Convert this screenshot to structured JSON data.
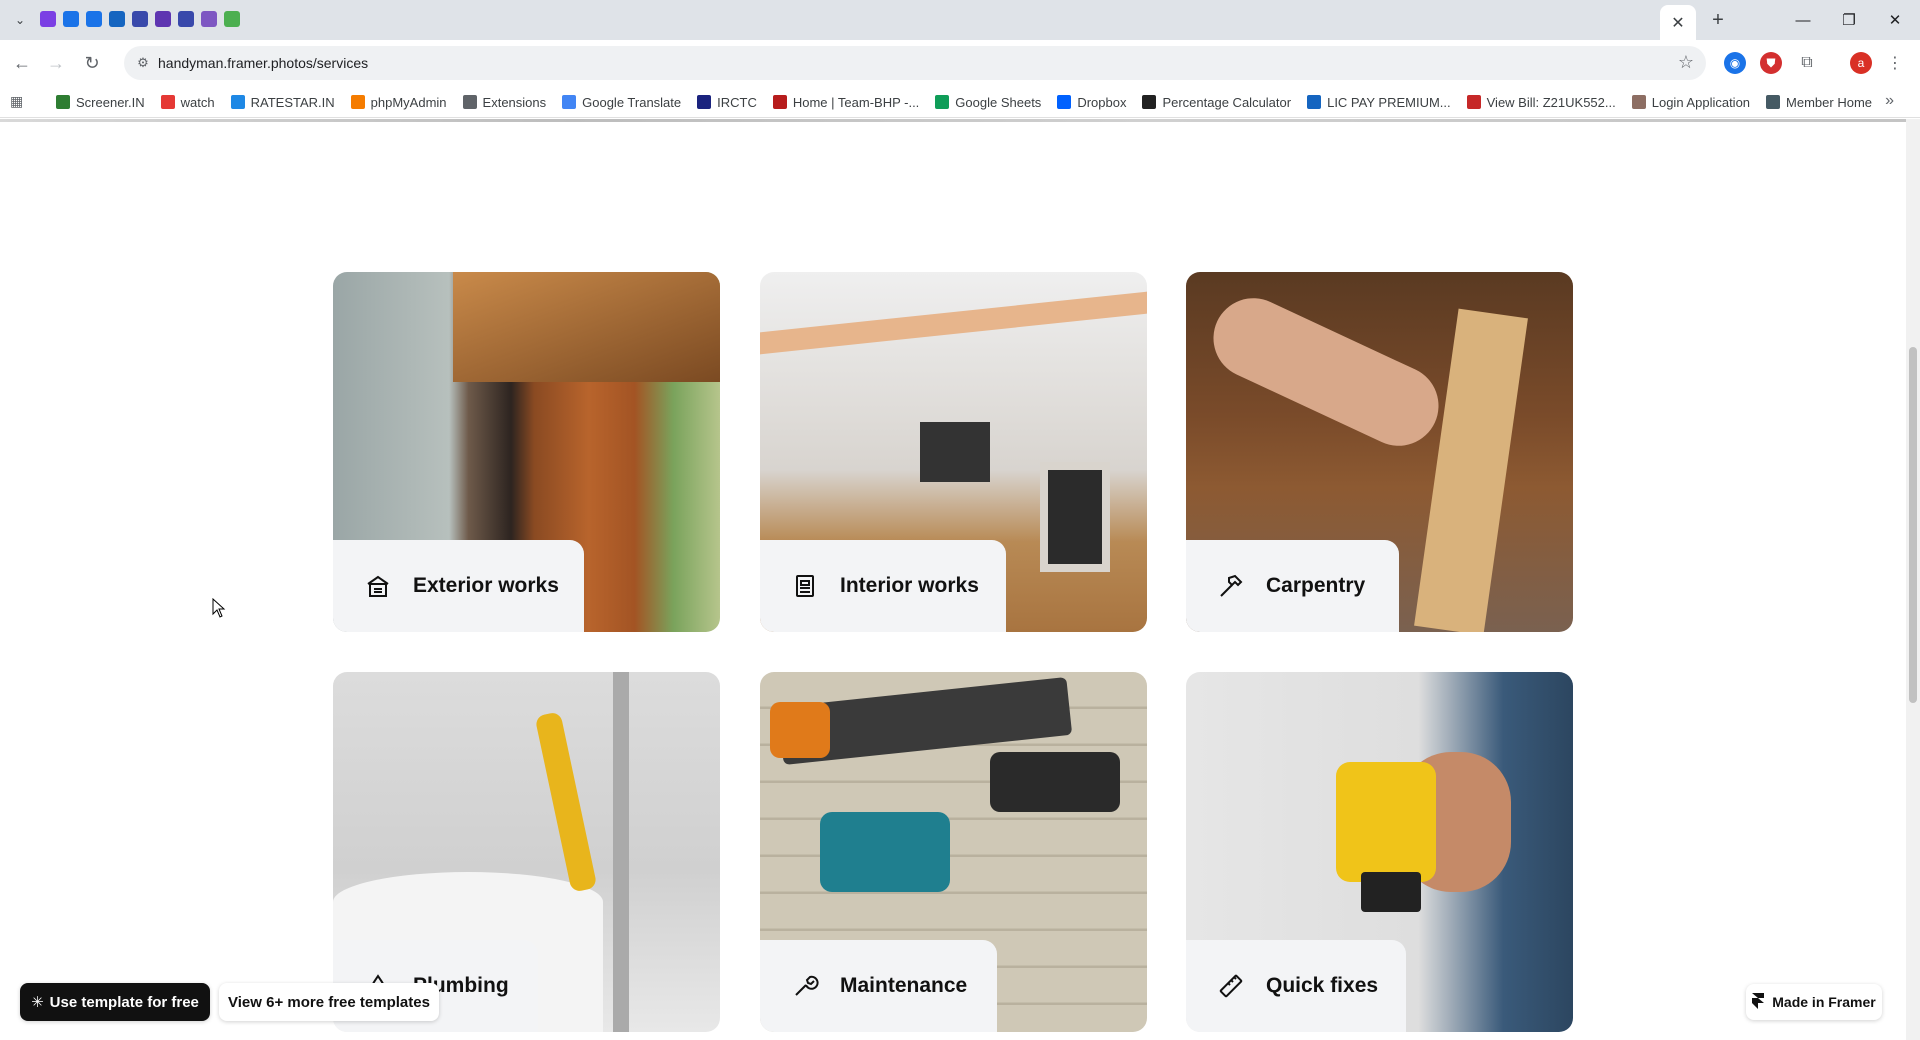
{
  "browser": {
    "url": "handyman.framer.photos/services",
    "tab_favicon_colors": [
      "#7b3fe4",
      "#1a73e8",
      "#1a73e8",
      "#1565c0",
      "#3949ab",
      "#5e35b1",
      "#3949ab",
      "#7e57c2",
      "#4caf50"
    ],
    "window_controls": {
      "minimize": "—",
      "maximize": "❐",
      "close": "✕"
    },
    "new_tab": "+",
    "active_tab_close": "✕",
    "profile_initial": "a"
  },
  "bookmarks": [
    {
      "label": "Screener.IN",
      "color": "#2e7d32"
    },
    {
      "label": "watch",
      "color": "#e53935"
    },
    {
      "label": "RATESTAR.IN",
      "color": "#1e88e5"
    },
    {
      "label": "phpMyAdmin",
      "color": "#f57c00"
    },
    {
      "label": "Extensions",
      "color": "#5f6368"
    },
    {
      "label": "Google Translate",
      "color": "#4285f4"
    },
    {
      "label": "IRCTC",
      "color": "#1a237e"
    },
    {
      "label": "Home | Team-BHP -...",
      "color": "#b71c1c"
    },
    {
      "label": "Google Sheets",
      "color": "#0f9d58"
    },
    {
      "label": "Dropbox",
      "color": "#0061fe"
    },
    {
      "label": "Percentage Calculator",
      "color": "#212121"
    },
    {
      "label": "LIC PAY PREMIUM...",
      "color": "#1565c0"
    },
    {
      "label": "View Bill: Z21UK552...",
      "color": "#c62828"
    },
    {
      "label": "Login Application",
      "color": "#8d6e63"
    },
    {
      "label": "Member Home",
      "color": "#455a64"
    }
  ],
  "services": [
    {
      "label": "Exterior works",
      "icon": "house-icon"
    },
    {
      "label": "Interior works",
      "icon": "interior-icon"
    },
    {
      "label": "Carpentry",
      "icon": "hammer-icon"
    },
    {
      "label": "Plumbing",
      "icon": "droplet-icon"
    },
    {
      "label": "Maintenance",
      "icon": "wrench-icon"
    },
    {
      "label": "Quick fixes",
      "icon": "ruler-icon"
    }
  ],
  "framer": {
    "use_template": "Use template for free",
    "more_templates": "View 6+ more free templates",
    "made_in": "Made in Framer"
  }
}
